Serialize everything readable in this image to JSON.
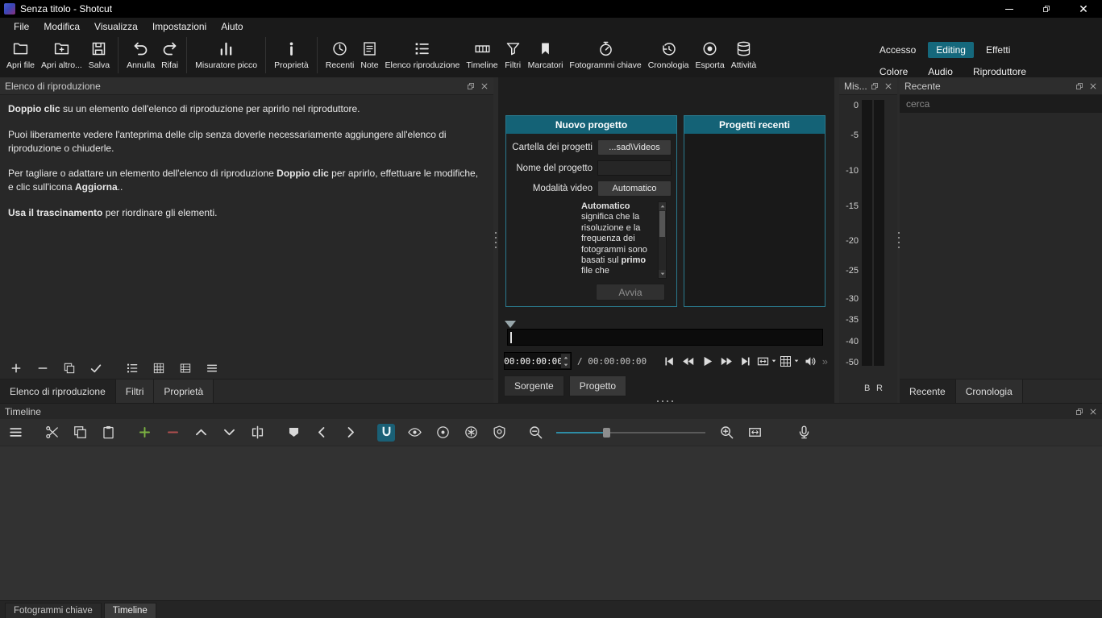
{
  "titlebar": {
    "title": "Senza titolo - Shotcut"
  },
  "menubar": {
    "items": [
      {
        "name": "menu-file",
        "label": "File"
      },
      {
        "name": "menu-modifica",
        "label": "Modifica"
      },
      {
        "name": "menu-visualizza",
        "label": "Visualizza"
      },
      {
        "name": "menu-impostazioni",
        "label": "Impostazioni"
      },
      {
        "name": "menu-aiuto",
        "label": "Aiuto"
      }
    ]
  },
  "toolbar": {
    "items": [
      {
        "name": "open-file-button",
        "icon": "i-folder",
        "label": "Apri file"
      },
      {
        "name": "open-other-button",
        "icon": "i-folder-plus",
        "label": "Apri altro..."
      },
      {
        "name": "save-button",
        "icon": "i-save",
        "label": "Salva"
      },
      {
        "name": "undo-button",
        "icon": "i-undo",
        "label": "Annulla",
        "cls": "grp"
      },
      {
        "name": "redo-button",
        "icon": "i-redo",
        "label": "Rifai"
      },
      {
        "name": "peak-meter-button",
        "icon": "i-meter",
        "label": "Misuratore picco",
        "cls": "grp"
      },
      {
        "name": "properties-button",
        "icon": "i-info",
        "label": "Proprietà",
        "cls": "grp"
      },
      {
        "name": "recent-button",
        "icon": "i-clock",
        "label": "Recenti",
        "cls": "grp"
      },
      {
        "name": "notes-button",
        "icon": "i-note",
        "label": "Note"
      },
      {
        "name": "playlist-button",
        "icon": "i-playlist",
        "label": "Elenco riproduzione"
      },
      {
        "name": "timeline-button",
        "icon": "i-timeline",
        "label": "Timeline"
      },
      {
        "name": "filters-button",
        "icon": "i-funnel",
        "label": "Filtri"
      },
      {
        "name": "markers-button",
        "icon": "i-bookmark",
        "label": "Marcatori"
      },
      {
        "name": "keyframes-button",
        "icon": "i-stopwatch",
        "label": "Fotogrammi chiave"
      },
      {
        "name": "history-button",
        "icon": "i-history",
        "label": "Cronologia"
      },
      {
        "name": "export-button",
        "icon": "i-record",
        "label": "Esporta"
      },
      {
        "name": "jobs-button",
        "icon": "i-layers",
        "label": "Attività"
      }
    ],
    "layout": {
      "row1": [
        "Accesso",
        "Editing",
        "Effetti"
      ],
      "row2": [
        "Colore",
        "Audio",
        "Riproduttore"
      ],
      "active": "Editing"
    }
  },
  "playlist": {
    "title": "Elenco di riproduzione",
    "p1": {
      "b": "Doppio clic",
      "t": " su un elemento dell'elenco di riproduzione per aprirlo nel riproduttore."
    },
    "p2": "Puoi liberamente vedere l'anteprima delle clip senza doverle necessariamente aggiungere all'elenco di riproduzione o chiuderle.",
    "p3": {
      "t1": "Per tagliare o adattare un elemento dell'elenco di riproduzione ",
      "b1": "Doppio clic",
      "t2": " per aprirlo, effettuare le modifiche, e clic sull'icona ",
      "b2": "Aggiorna",
      "t3": ".."
    },
    "p4": {
      "b": "Usa il trascinamento",
      "t": " per riordinare gli elementi."
    },
    "tools": [
      {
        "name": "playlist-add-button",
        "icon": "i-plus"
      },
      {
        "name": "playlist-remove-button",
        "icon": "i-minus"
      },
      {
        "name": "playlist-update-button",
        "icon": "i-copy"
      },
      {
        "name": "playlist-check-button",
        "icon": "i-check"
      },
      {
        "name": "view-details-button",
        "icon": "i-playlist",
        "cls": "gap"
      },
      {
        "name": "view-tiles-button",
        "icon": "i-grid"
      },
      {
        "name": "view-icons-button",
        "icon": "i-details"
      },
      {
        "name": "playlist-menu-button",
        "icon": "i-menu"
      }
    ],
    "tabs": [
      "Elenco di riproduzione",
      "Filtri",
      "Proprietà"
    ]
  },
  "new_project": {
    "title": "Nuovo progetto",
    "folder_label": "Cartella dei progetti",
    "folder_value": "...sad\\Videos",
    "name_label": "Nome del progetto",
    "mode_label": "Modalità video",
    "mode_value": "Automatico",
    "desc": {
      "b1": "Automatico",
      "t1": " significa che la risoluzione e la frequenza dei fotogrammi sono basati sul ",
      "b2": "primo",
      "t2": " file che"
    },
    "start_label": "Avvia"
  },
  "recent_projects": {
    "title": "Progetti recenti"
  },
  "player": {
    "current": "00:00:00:00",
    "sep": "/",
    "total": "00:00:00:00",
    "buttons": [
      {
        "name": "skip-start-button",
        "icon": "i-skip-start"
      },
      {
        "name": "rewind-button",
        "icon": "i-rewind"
      },
      {
        "name": "play-button",
        "icon": "i-play"
      },
      {
        "name": "fast-forward-button",
        "icon": "i-ffwd"
      },
      {
        "name": "skip-end-button",
        "icon": "i-skip-end"
      }
    ],
    "overflow": "»",
    "tabs": [
      "Sorgente",
      "Progetto"
    ]
  },
  "meter": {
    "title": "Mis...",
    "scale": [
      "0",
      "-5",
      "-10",
      "-15",
      "-20",
      "-25",
      "-30",
      "-35",
      "-40",
      "-50"
    ],
    "channel_left": "B",
    "channel_right": "R"
  },
  "recent_panel": {
    "title": "Recente",
    "search_placeholder": "cerca",
    "tabs": [
      "Recente",
      "Cronologia"
    ]
  },
  "timeline": {
    "title": "Timeline",
    "tools_left": [
      {
        "name": "timeline-menu-button",
        "icon": "i-menu"
      },
      {
        "name": "cut-button",
        "icon": "i-cut",
        "cls": "gap"
      },
      {
        "name": "copy-button",
        "icon": "i-copy"
      },
      {
        "name": "paste-button",
        "icon": "i-paste"
      },
      {
        "name": "append-button",
        "icon": "i-plus",
        "cls": "green gap"
      },
      {
        "name": "ripple-delete-button",
        "icon": "i-minus",
        "cls": "red"
      },
      {
        "name": "lift-button",
        "icon": "i-chev-up"
      },
      {
        "name": "overwrite-button",
        "icon": "i-chev-down"
      },
      {
        "name": "split-button",
        "icon": "i-split"
      },
      {
        "name": "marker-button",
        "icon": "i-flag",
        "cls": "gap"
      },
      {
        "name": "prev-marker-button",
        "icon": "i-chev-left"
      },
      {
        "name": "next-marker-button",
        "icon": "i-chev-right"
      },
      {
        "name": "snap-button",
        "icon": "i-magnet",
        "cls": "active gap"
      },
      {
        "name": "scrub-while-dragging-button",
        "icon": "i-eye"
      },
      {
        "name": "ripple-button",
        "icon": "i-circle-dot"
      },
      {
        "name": "ripple-all-tracks-button",
        "icon": "i-circle-star"
      },
      {
        "name": "ripple-markers-button",
        "icon": "i-shield"
      },
      {
        "name": "zoom-out-button",
        "icon": "i-zoom-out",
        "cls": "gap"
      }
    ],
    "tools_right": [
      {
        "name": "zoom-in-button",
        "icon": "i-zoom-in"
      },
      {
        "name": "zoom-fit-button",
        "icon": "i-fit"
      }
    ]
  },
  "bottom_tabs": {
    "keyframes": "Fotogrammi chiave",
    "timeline": "Timeline"
  }
}
